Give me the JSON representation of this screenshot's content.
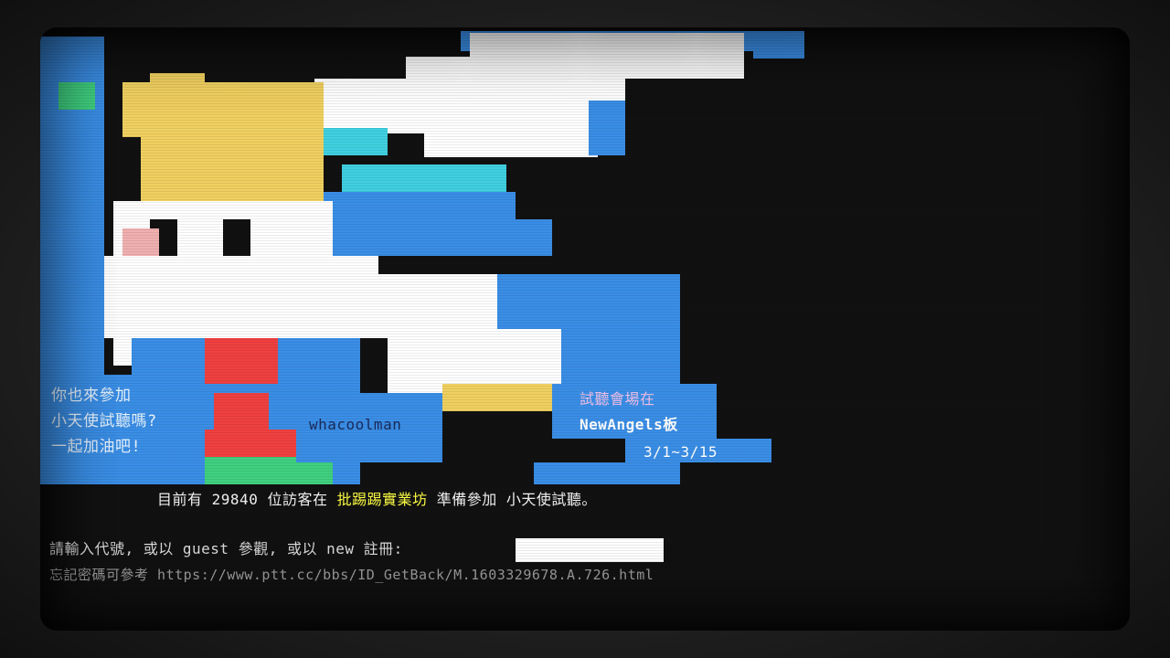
{
  "promo": {
    "line1": "你也來參加",
    "line2": "小天使試聽嗎?",
    "line3": "一起加油吧!"
  },
  "art_user": "whacoolman",
  "board_promo": {
    "label": "試聽會場在",
    "board": "NewAngels板",
    "dates": "3/1~3/15"
  },
  "status": {
    "prefix": "目前有",
    "count": "29840",
    "middle": "位訪客在",
    "site": "批踢踢實業坊",
    "suffix": "準備參加 小天使試聽。"
  },
  "login": {
    "prompt": "請輸入代號, 或以 guest 參觀, 或以 new 註冊:",
    "value": ""
  },
  "hint": {
    "label": "忘記密碼可參考",
    "url": "https://www.ptt.cc/bbs/ID_GetBack/M.1603329678.A.726.html"
  },
  "colors": {
    "sky_blue": "#3a8ee6",
    "cyan": "#40d0e0",
    "hair_yellow": "#f0d060",
    "white": "#ffffff",
    "red": "#f04040",
    "green": "#40d080"
  }
}
